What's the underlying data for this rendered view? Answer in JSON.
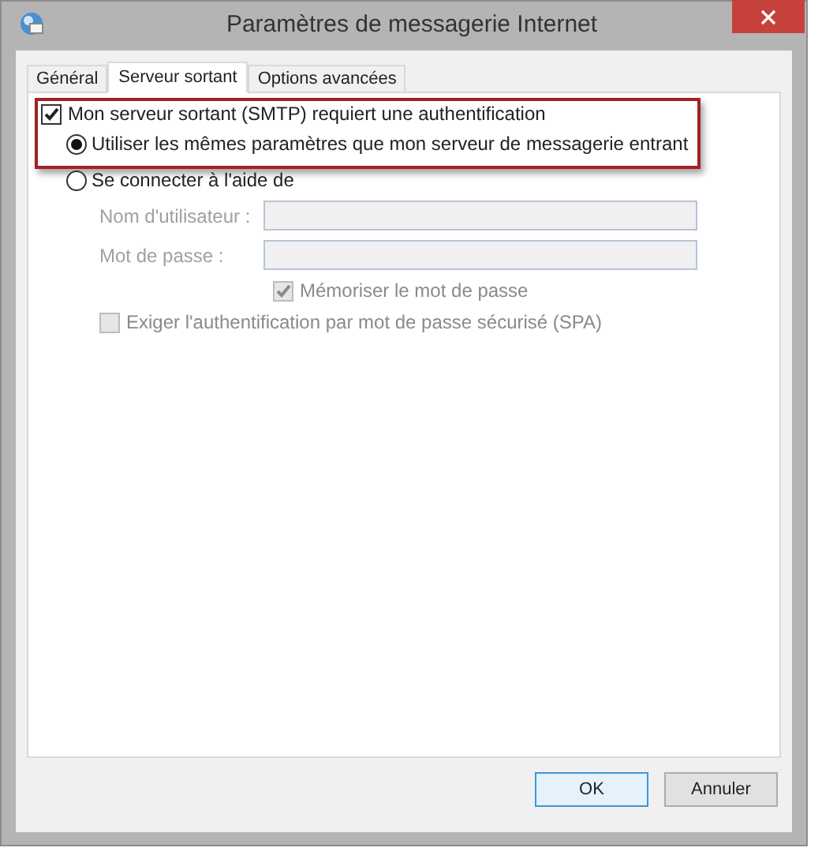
{
  "window": {
    "title": "Paramètres de messagerie Internet"
  },
  "tabs": [
    {
      "label": "Général",
      "selected": false
    },
    {
      "label": "Serveur sortant",
      "selected": true
    },
    {
      "label": "Options avancées",
      "selected": false
    }
  ],
  "auth_required": {
    "label": "Mon serveur sortant (SMTP) requiert une authentification",
    "checked": true
  },
  "auth_options": [
    {
      "label": "Utiliser les mêmes paramètres que mon serveur de messagerie entrant",
      "selected": true
    },
    {
      "label": "Se connecter à l'aide de",
      "selected": false
    }
  ],
  "fields": [
    {
      "label": "Nom d'utilisateur :",
      "disabled": true
    },
    {
      "label": "Mot de passe :",
      "disabled": true
    }
  ],
  "remember_password": {
    "label": "Mémoriser le mot de passe",
    "checked": true,
    "disabled": true
  },
  "require_spa": {
    "label": "Exiger l'authentification par mot de passe sécurisé (SPA)",
    "checked": false,
    "disabled": true
  },
  "buttons": [
    {
      "label": "OK",
      "default": true
    },
    {
      "label": "Annuler",
      "default": false
    }
  ]
}
